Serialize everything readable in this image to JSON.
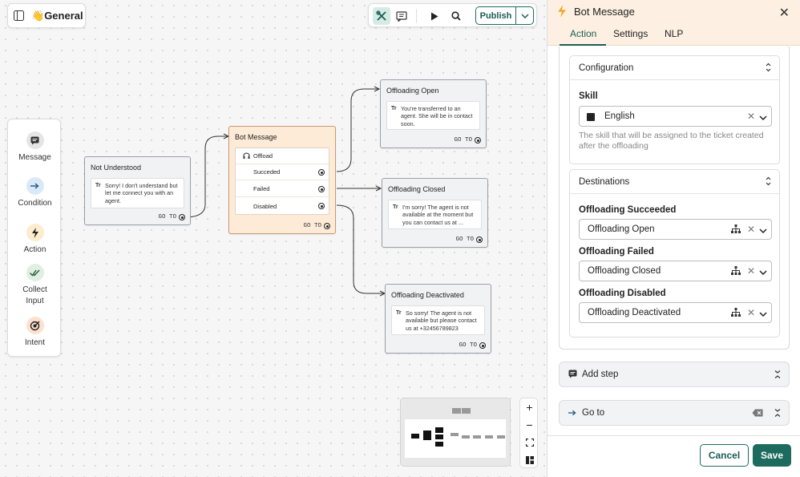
{
  "flow": {
    "emoji": "👋",
    "name": "General"
  },
  "toolbar": {
    "publish_label": "Publish"
  },
  "palette": {
    "items": [
      {
        "label": "Message",
        "icon": "message-icon",
        "color": "#e5e5e5"
      },
      {
        "label": "Condition",
        "icon": "arrow-right-icon",
        "color": "#dbe9f7"
      },
      {
        "label": "Action",
        "icon": "bolt-icon",
        "color": "#fdeccd"
      },
      {
        "label": "Collect Input",
        "icon": "double-check-icon",
        "color": "#dff0e2"
      },
      {
        "label": "Intent",
        "icon": "target-icon",
        "color": "#fde1cf"
      }
    ]
  },
  "nodes": {
    "not_understood": {
      "title": "Not Understood",
      "message": "Sorry! I don't understand but let me connect you with an agent.",
      "goto": "GO TO"
    },
    "bot_message": {
      "title": "Bot Message",
      "offload": "Offload",
      "rows": [
        "Succeded",
        "Failed",
        "Disabled"
      ],
      "goto": "GO TO"
    },
    "offloading_open": {
      "title": "Offloading Open",
      "message": "You're transferred to an agent. She will be in contact soon.",
      "goto": "GO TO"
    },
    "offloading_closed": {
      "title": "Offloading Closed",
      "message": "I'm sorry! The agent is not available at the moment but you can contact us at ...",
      "goto": "GO TO"
    },
    "offloading_deactivated": {
      "title": "Offloading Deactivated",
      "message": "So sorry! The agent is not available but please contact us at +32456789823",
      "goto": "GO TO"
    }
  },
  "panel": {
    "title": "Bot Message",
    "tabs": [
      "Action",
      "Settings",
      "NLP"
    ],
    "active_tab": "Action",
    "configuration": {
      "heading": "Configuration",
      "skill_label": "Skill",
      "skill_value": "English",
      "skill_hint": "The skill that will be assigned to the ticket created after the offloading"
    },
    "destinations": {
      "heading": "Destinations",
      "fields": [
        {
          "label": "Offloading Succeeded",
          "value": "Offloading Open"
        },
        {
          "label": "Offloading Failed",
          "value": "Offloading Closed"
        },
        {
          "label": "Offloading Disabled",
          "value": "Offloading Deactivated"
        }
      ]
    },
    "add_step": "Add step",
    "go_to": "Go to",
    "cancel_label": "Cancel",
    "save_label": "Save"
  },
  "colors": {
    "accent": "#1c6b5e",
    "bot_node": "#fdebd8",
    "panel_header": "#fdf0e2"
  }
}
